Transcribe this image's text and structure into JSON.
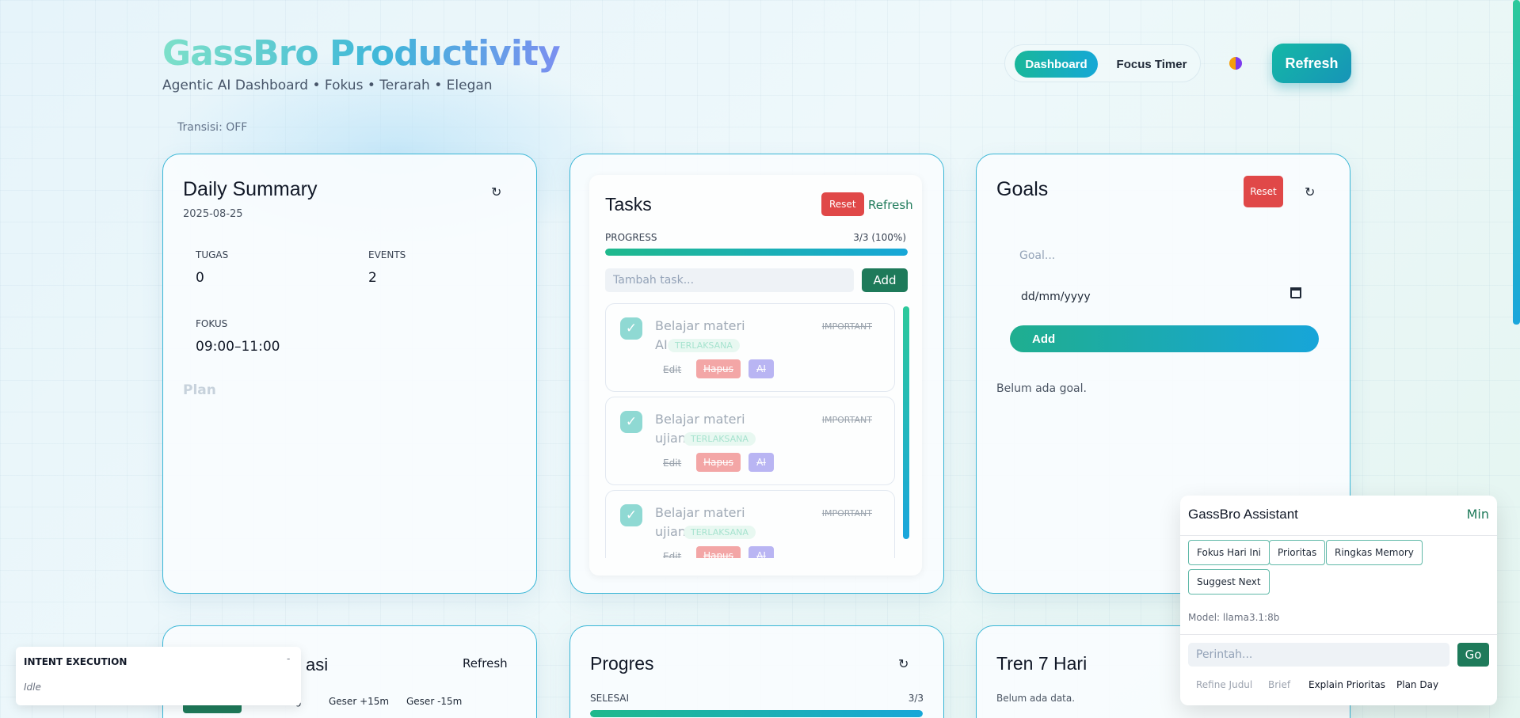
{
  "header": {
    "title": "GassBro Productivity",
    "subtitle": "Agentic AI Dashboard • Fokus • Terarah • Elegan",
    "transition": "Transisi: OFF",
    "nav": {
      "dashboard": "Dashboard",
      "focus_timer": "Focus Timer"
    },
    "refresh": "Refresh"
  },
  "daily_summary": {
    "title": "Daily Summary",
    "date": "2025-08-25",
    "refresh_icon": "↻",
    "stats": {
      "tugas_label": "TUGAS",
      "tugas_value": "0",
      "events_label": "EVENTS",
      "events_value": "2",
      "fokus_label": "FOKUS",
      "fokus_value": "09:00–11:00"
    },
    "plan": "Plan"
  },
  "tasks": {
    "title": "Tasks",
    "reset": "Reset",
    "refresh": "Refresh",
    "progress_label": "PROGRESS",
    "progress_text": "3/3 (100%)",
    "progress_fraction": 1.0,
    "input_placeholder": "Tambah task...",
    "add": "Add",
    "items": [
      {
        "title": "Belajar materi AI",
        "tag": "IMPORTANT",
        "status": "TERLAKSANA",
        "edit": "Edit",
        "delete": "Hapus",
        "ai": "AI"
      },
      {
        "title": "Belajar materi ujian",
        "tag": "IMPORTANT",
        "status": "TERLAKSANA",
        "edit": "Edit",
        "delete": "Hapus",
        "ai": "AI"
      },
      {
        "title": "Belajar materi ujian",
        "tag": "IMPORTANT",
        "status": "TERLAKSANA",
        "edit": "Edit",
        "delete": "Hapus",
        "ai": "AI"
      }
    ]
  },
  "goals": {
    "title": "Goals",
    "reset": "Reset",
    "refresh_icon": "↻",
    "goal_placeholder": "Goal...",
    "date_placeholder": "dd/mm/yyyy",
    "add": "Add",
    "empty": "Belum ada goal."
  },
  "assistant": {
    "title": "GassBro Assistant",
    "min": "Min",
    "chips": [
      "Fokus Hari Ini",
      "Prioritas",
      "Ringkas Memory",
      "Suggest Next"
    ],
    "model": "Model: llama3.1:8b",
    "input_placeholder": "Perintah...",
    "go": "Go",
    "links": [
      "Refine Judul",
      "Brief",
      "Explain Prioritas",
      "Plan Day"
    ]
  },
  "intent": {
    "title": "INTENT EXECUTION",
    "dash": "-",
    "state": "Idle"
  },
  "bottom": {
    "card1_title": "asi",
    "card1_refresh": "Refresh",
    "card1_chips": [
      "g",
      "Geser +15m",
      "Geser -15m"
    ],
    "progres_title": "Progres",
    "progres_refresh_icon": "↻",
    "selesai_label": "SELESAI",
    "selesai_value": "3/3",
    "selesai_fraction": 1.0,
    "tren_title": "Tren 7 Hari",
    "tren_empty": "Belum ada data."
  },
  "colors": {
    "accent_teal": "#18b79a",
    "accent_blue": "#16a8d6",
    "danger": "#e04848",
    "dark_green": "#1e7a5a"
  }
}
